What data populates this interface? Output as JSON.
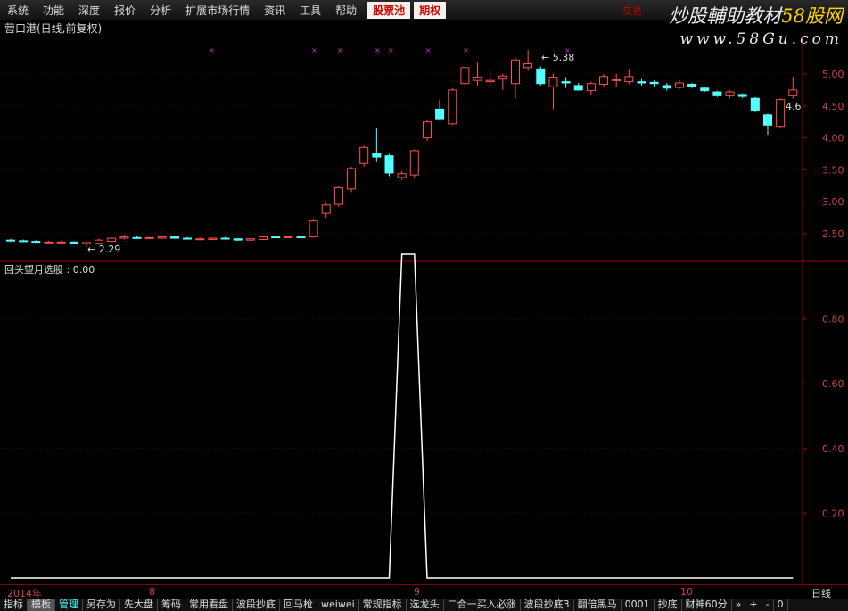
{
  "menu": [
    "系统",
    "功能",
    "深度",
    "报价",
    "分析",
    "扩展市场行情",
    "资讯",
    "工具",
    "帮助"
  ],
  "menu_highlight": [
    "股票池",
    "期权"
  ],
  "trade_label": "交易",
  "logo": {
    "line1": "炒股輔助教材",
    "line1_accent": "58股网",
    "line2": "www.58Gu.com"
  },
  "chart_title": "营口港(日线,前复权)",
  "indicator_title": "回头望月选股 : 0.00",
  "price_labels": {
    "high": "5.38",
    "low": "2.29",
    "last": "4.6"
  },
  "colors": {
    "up": "#ff5050",
    "down": "#54ffff",
    "bg": "#000000",
    "grid": "#800000"
  },
  "chart_data": [
    {
      "type": "candlestick",
      "yticks": [
        2.5,
        3.0,
        3.5,
        4.0,
        4.5,
        5.0
      ],
      "ytick_labels": [
        "2.50",
        "3.00",
        "3.50",
        "4.00",
        "4.50",
        "5.00"
      ],
      "ylim": [
        2.1,
        5.55
      ],
      "ohlc": [
        [
          2.4,
          2.42,
          2.37,
          2.39
        ],
        [
          2.39,
          2.41,
          2.37,
          2.38
        ],
        [
          2.38,
          2.4,
          2.36,
          2.37
        ],
        [
          2.37,
          2.39,
          2.35,
          2.37
        ],
        [
          2.36,
          2.39,
          2.34,
          2.37
        ],
        [
          2.37,
          2.38,
          2.34,
          2.35
        ],
        [
          2.34,
          2.38,
          2.29,
          2.36
        ],
        [
          2.35,
          2.42,
          2.33,
          2.4
        ],
        [
          2.38,
          2.44,
          2.37,
          2.43
        ],
        [
          2.43,
          2.48,
          2.41,
          2.45
        ],
        [
          2.44,
          2.46,
          2.42,
          2.43
        ],
        [
          2.43,
          2.45,
          2.42,
          2.44
        ],
        [
          2.43,
          2.46,
          2.42,
          2.45
        ],
        [
          2.45,
          2.46,
          2.42,
          2.43
        ],
        [
          2.43,
          2.45,
          2.41,
          2.42
        ],
        [
          2.42,
          2.44,
          2.4,
          2.42
        ],
        [
          2.41,
          2.44,
          2.4,
          2.43
        ],
        [
          2.43,
          2.45,
          2.41,
          2.42
        ],
        [
          2.42,
          2.43,
          2.39,
          2.4
        ],
        [
          2.4,
          2.43,
          2.39,
          2.42
        ],
        [
          2.41,
          2.46,
          2.4,
          2.45
        ],
        [
          2.45,
          2.46,
          2.43,
          2.44
        ],
        [
          2.44,
          2.46,
          2.43,
          2.45
        ],
        [
          2.45,
          2.46,
          2.43,
          2.44
        ],
        [
          2.45,
          2.72,
          2.44,
          2.7
        ],
        [
          2.82,
          2.98,
          2.75,
          2.95
        ],
        [
          2.96,
          3.25,
          2.92,
          3.22
        ],
        [
          3.2,
          3.55,
          3.15,
          3.52
        ],
        [
          3.6,
          3.88,
          3.55,
          3.85
        ],
        [
          3.75,
          4.15,
          3.62,
          3.7
        ],
        [
          3.72,
          3.75,
          3.4,
          3.45
        ],
        [
          3.38,
          3.48,
          3.34,
          3.44
        ],
        [
          3.42,
          3.82,
          3.38,
          3.8
        ],
        [
          4.0,
          4.28,
          3.95,
          4.25
        ],
        [
          4.45,
          4.6,
          4.28,
          4.3
        ],
        [
          4.22,
          4.78,
          4.2,
          4.75
        ],
        [
          4.85,
          5.12,
          4.75,
          5.1
        ],
        [
          4.9,
          5.18,
          4.82,
          4.95
        ],
        [
          4.88,
          5.05,
          4.8,
          4.9
        ],
        [
          4.92,
          5.0,
          4.75,
          4.97
        ],
        [
          4.85,
          5.25,
          4.62,
          5.22
        ],
        [
          5.1,
          5.38,
          5.05,
          5.16
        ],
        [
          5.08,
          5.12,
          4.82,
          4.85
        ],
        [
          4.8,
          5.0,
          4.45,
          4.95
        ],
        [
          4.88,
          4.95,
          4.78,
          4.86
        ],
        [
          4.82,
          4.86,
          4.74,
          4.75
        ],
        [
          4.74,
          4.88,
          4.68,
          4.85
        ],
        [
          4.84,
          5.0,
          4.8,
          4.96
        ],
        [
          4.9,
          5.0,
          4.8,
          4.91
        ],
        [
          4.88,
          5.08,
          4.84,
          4.96
        ],
        [
          4.88,
          4.92,
          4.82,
          4.86
        ],
        [
          4.87,
          4.9,
          4.8,
          4.85
        ],
        [
          4.82,
          4.86,
          4.74,
          4.78
        ],
        [
          4.79,
          4.9,
          4.76,
          4.86
        ],
        [
          4.84,
          4.86,
          4.78,
          4.81
        ],
        [
          4.78,
          4.8,
          4.72,
          4.74
        ],
        [
          4.72,
          4.74,
          4.64,
          4.66
        ],
        [
          4.66,
          4.75,
          4.62,
          4.72
        ],
        [
          4.68,
          4.7,
          4.62,
          4.65
        ],
        [
          4.62,
          4.64,
          4.4,
          4.42
        ],
        [
          4.36,
          4.38,
          4.05,
          4.2
        ],
        [
          4.18,
          4.62,
          4.15,
          4.6
        ],
        [
          4.66,
          4.96,
          4.62,
          4.75
        ]
      ]
    },
    {
      "type": "line",
      "name": "回头望月选股",
      "yticks": [
        0.2,
        0.4,
        0.6,
        0.8
      ],
      "ytick_labels": [
        "0.20",
        "0.40",
        "0.60",
        "0.80"
      ],
      "ylim": [
        0,
        1
      ],
      "values": [
        0,
        0,
        0,
        0,
        0,
        0,
        0,
        0,
        0,
        0,
        0,
        0,
        0,
        0,
        0,
        0,
        0,
        0,
        0,
        0,
        0,
        0,
        0,
        0,
        0,
        0,
        0,
        0,
        0,
        0,
        0,
        1,
        1,
        0,
        0,
        0,
        0,
        0,
        0,
        0,
        0,
        0,
        0,
        0,
        0,
        0,
        0,
        0,
        0,
        0,
        0,
        0,
        0,
        0,
        0,
        0,
        0,
        0,
        0,
        0,
        0,
        0,
        0
      ]
    }
  ],
  "xaxis": {
    "labels": [
      "2014年",
      "8",
      "9",
      "10"
    ],
    "period": "日线"
  },
  "tabs": [
    "指标",
    "模板",
    "管理",
    "另存为",
    "先大盘",
    "筹码",
    "常用看盘",
    "波段抄底",
    "回马枪",
    "weiwei",
    "常规指标",
    "选龙头",
    "二合一买入必涨",
    "波段抄底3",
    "翻倍黑马",
    "0001",
    "抄底",
    "财神60分",
    "»",
    "+",
    "-",
    "0"
  ]
}
